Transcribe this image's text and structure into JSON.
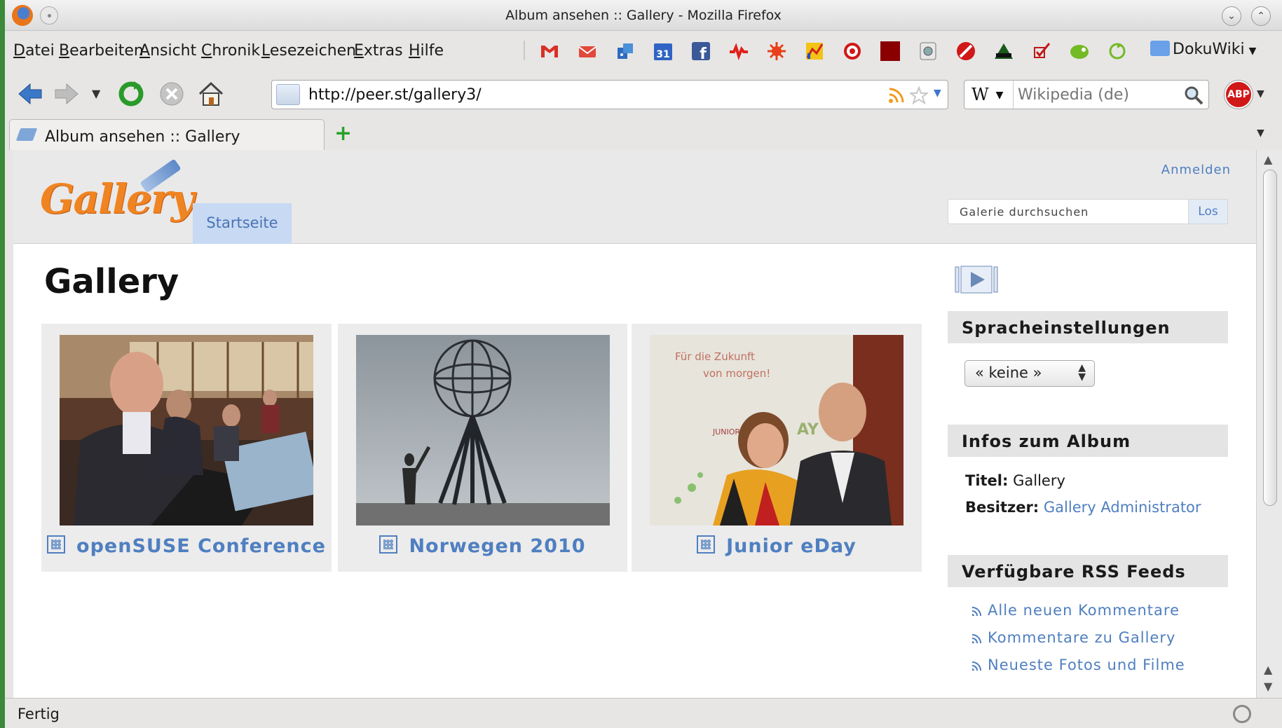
{
  "window": {
    "title": "Album ansehen :: Gallery - Mozilla Firefox"
  },
  "menubar": {
    "items": [
      "Datei",
      "Bearbeiten",
      "Ansicht",
      "Chronik",
      "Lesezeichen",
      "Extras",
      "Hilfe"
    ],
    "bookmark_icons": [
      "gmail-icon",
      "mail-icon",
      "feed-icon",
      "calendar-icon",
      "facebook-icon",
      "activity-icon",
      "star-burst-icon",
      "chart-icon",
      "target-icon",
      "red-square-icon",
      "photo-icon",
      "blocked-icon",
      "zone-icon",
      "checkmark-icon",
      "opensuse-icon",
      "refresh-green-icon"
    ],
    "folder_label": "DokuWiki"
  },
  "navbar": {
    "url": "http://peer.st/gallery3/",
    "search_placeholder": "Wikipedia (de)",
    "search_engine": "W",
    "abp_label": "ABP"
  },
  "tabs": [
    {
      "label": "Album ansehen :: Gallery"
    }
  ],
  "gallery": {
    "logo_text": "Gallery",
    "nav_tab": "Startseite",
    "login_link": "Anmelden",
    "search_placeholder": "Galerie durchsuchen",
    "search_button": "Los",
    "page_title": "Gallery",
    "albums": [
      {
        "title": "openSUSE Conference"
      },
      {
        "title": "Norwegen 2010"
      },
      {
        "title": "Junior eDay",
        "photo_text_1": "Für die Zukunft",
        "photo_text_2": "von morgen!",
        "photo_text_3": "JUNIOR",
        "photo_text_4": "AY"
      }
    ],
    "sidebar": {
      "language_heading": "Spracheinstellungen",
      "language_value": "« keine »",
      "album_info_heading": "Infos zum Album",
      "title_label": "Titel:",
      "title_value": "Gallery",
      "owner_label": "Besitzer:",
      "owner_value": "Gallery Administrator",
      "rss_heading": "Verfügbare RSS Feeds",
      "rss_feeds": [
        "Alle neuen Kommentare",
        "Kommentare zu Gallery",
        "Neueste Fotos und Filme"
      ]
    }
  },
  "statusbar": {
    "text": "Fertig"
  },
  "colors": {
    "link": "#4f7fc0",
    "logo": "#f08422",
    "tab_active_bg": "#c7d9f3"
  }
}
